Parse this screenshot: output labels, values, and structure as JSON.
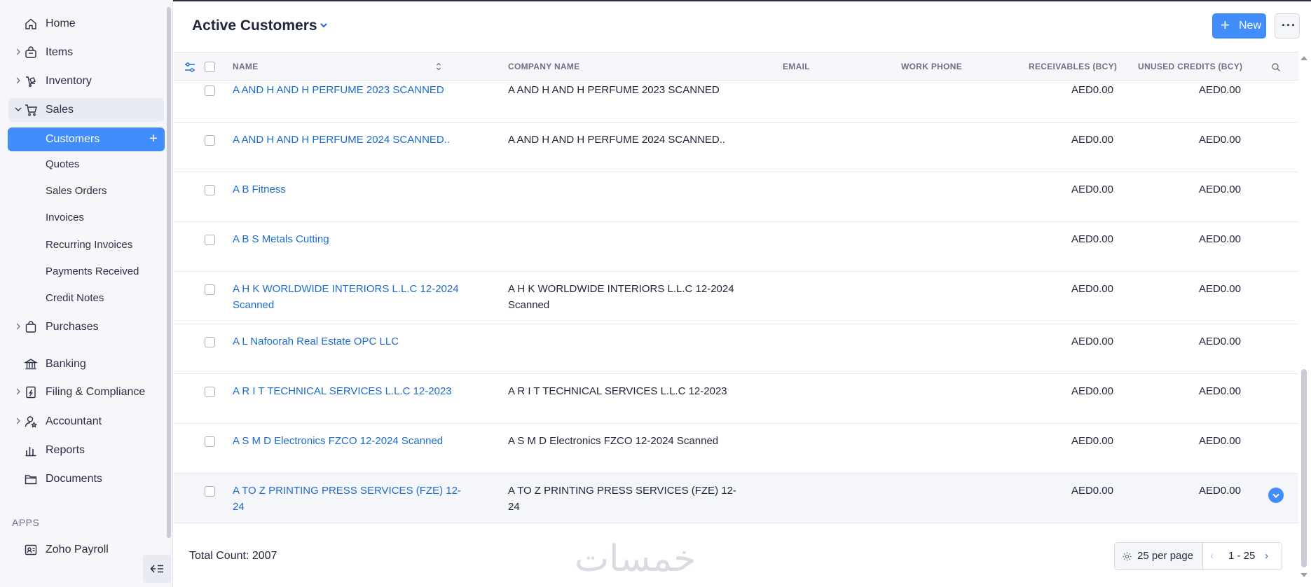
{
  "sidebar": {
    "home": "Home",
    "items": "Items",
    "inventory": "Inventory",
    "sales": "Sales",
    "customers": "Customers",
    "quotes": "Quotes",
    "sales_orders": "Sales Orders",
    "invoices": "Invoices",
    "recurring_invoices": "Recurring Invoices",
    "payments_received": "Payments Received",
    "credit_notes": "Credit Notes",
    "purchases": "Purchases",
    "banking": "Banking",
    "filing": "Filing & Compliance",
    "accountant": "Accountant",
    "reports": "Reports",
    "documents": "Documents",
    "apps_label": "APPS",
    "zoho_payroll": "Zoho Payroll"
  },
  "header": {
    "title": "Active Customers",
    "new_label": "New",
    "more_label": "···"
  },
  "table": {
    "columns": {
      "name": "NAME",
      "company": "COMPANY NAME",
      "email": "EMAIL",
      "phone": "WORK PHONE",
      "receivables": "RECEIVABLES (BCY)",
      "credits": "UNUSED CREDITS (BCY)"
    },
    "rows": [
      {
        "name": "A AND H AND H PERFUME 2023 SCANNED",
        "company": "A AND H AND H PERFUME 2023 SCANNED",
        "receivables": "AED0.00",
        "credits": "AED0.00"
      },
      {
        "name": "A AND H AND H PERFUME 2024 SCANNED..",
        "company": "A AND H AND H PERFUME 2024 SCANNED..",
        "receivables": "AED0.00",
        "credits": "AED0.00"
      },
      {
        "name": "A B Fitness",
        "company": "",
        "receivables": "AED0.00",
        "credits": "AED0.00"
      },
      {
        "name": "A B S Metals Cutting",
        "company": "",
        "receivables": "AED0.00",
        "credits": "AED0.00"
      },
      {
        "name": "A H K WORLDWIDE INTERIORS L.L.C 12-2024 Scanned",
        "company": "A H K WORLDWIDE INTERIORS L.L.C 12-2024 Scanned",
        "receivables": "AED0.00",
        "credits": "AED0.00"
      },
      {
        "name": "A L Nafoorah Real Estate OPC LLC",
        "company": "",
        "receivables": "AED0.00",
        "credits": "AED0.00"
      },
      {
        "name": "A R I T TECHNICAL SERVICES L.L.C 12-2023",
        "company": "A R I T TECHNICAL SERVICES L.L.C 12-2023",
        "receivables": "AED0.00",
        "credits": "AED0.00"
      },
      {
        "name": "A S M D Electronics FZCO 12-2024 Scanned",
        "company": "A S M D Electronics FZCO 12-2024 Scanned",
        "receivables": "AED0.00",
        "credits": "AED0.00"
      },
      {
        "name": "A TO Z PRINTING PRESS SERVICES (FZE) 12-24",
        "company": "A TO Z PRINTING PRESS SERVICES (FZE) 12-24",
        "receivables": "AED0.00",
        "credits": "AED0.00"
      }
    ]
  },
  "footer": {
    "total_count": "Total Count: 2007",
    "watermark": "خمسات",
    "per_page": "25 per page",
    "range": "1 - 25",
    "prev": "‹",
    "next": "›"
  },
  "colors": {
    "accent": "#408dfb",
    "link": "#1b6ccf"
  }
}
